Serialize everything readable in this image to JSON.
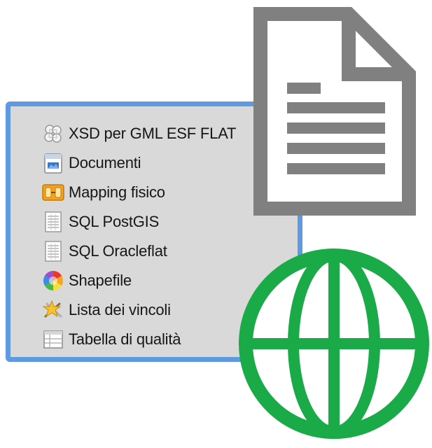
{
  "items": [
    {
      "label": "XSD per GML ESF FLAT",
      "icon": "xsd-schema-icon"
    },
    {
      "label": "Documenti",
      "icon": "document-icon"
    },
    {
      "label": "Mapping fisico",
      "icon": "mapping-icon"
    },
    {
      "label": "SQL PostGIS",
      "icon": "sql-sheet-icon"
    },
    {
      "label": "SQL Oracleflat",
      "icon": "sql-sheet-icon"
    },
    {
      "label": "Shapefile",
      "icon": "color-wheel-icon"
    },
    {
      "label": "Lista dei vincoli",
      "icon": "star-tools-icon"
    },
    {
      "label": "Tabella di qualità",
      "icon": "table-icon"
    }
  ],
  "colors": {
    "panel_border": "#5f9ae0",
    "panel_background": "#d9d9d9",
    "document_overlay": "#808080",
    "globe_overlay": "#1aab48"
  },
  "overlays": {
    "document": "file-text-icon",
    "globe": "globe-icon"
  }
}
